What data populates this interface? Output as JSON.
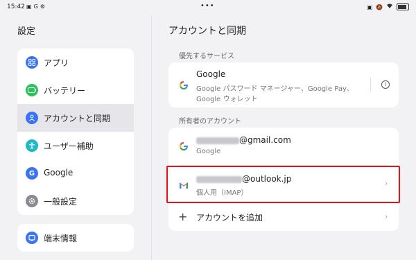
{
  "status_bar": {
    "time": "15:42",
    "dots": "•••"
  },
  "left": {
    "title": "設定",
    "menu": [
      {
        "label": "アプリ",
        "icon": "apps-icon",
        "color": "#3a73f5"
      },
      {
        "label": "バッテリー",
        "icon": "battery-icon",
        "color": "#2ec25a"
      },
      {
        "label": "アカウントと同期",
        "icon": "person-icon",
        "color": "#3a73f5",
        "active": true
      },
      {
        "label": "ユーザー補助",
        "icon": "accessibility-icon",
        "color": "#20b9c8"
      },
      {
        "label": "Google",
        "icon": "google-icon",
        "color": "#3a73f5"
      },
      {
        "label": "一般設定",
        "icon": "gear-icon",
        "color": "#8a8a90"
      }
    ],
    "device": {
      "label": "端末情報",
      "icon": "tablet-icon",
      "color": "#3a73f5"
    }
  },
  "right": {
    "title": "アカウントと同期",
    "preferred_label": "優先するサービス",
    "google_service": {
      "title": "Google",
      "desc_line1": "Google パスワード マネージャー、Google Pay、",
      "desc_line2": "Google ウォレット"
    },
    "owner_label": "所有者のアカウント",
    "accounts": [
      {
        "email_suffix": "@gmail.com",
        "sub": "Google",
        "icon": "google-icon"
      },
      {
        "email_suffix": "@outlook.jp",
        "sub": "個人用（IMAP）",
        "icon": "gmail-icon"
      }
    ],
    "add_account": "アカウントを追加"
  },
  "colors": {
    "accent": "#3a73f5",
    "highlight": "#e0131b"
  }
}
